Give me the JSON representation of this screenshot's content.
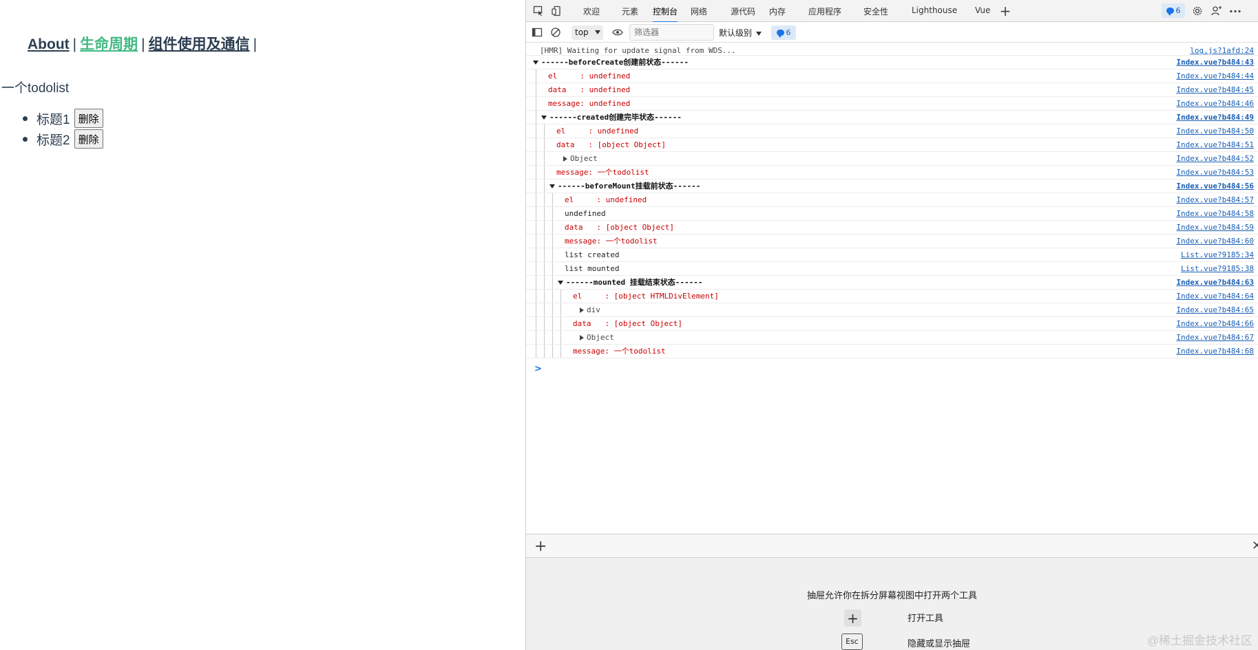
{
  "app": {
    "nav": [
      {
        "label": "About",
        "active": false
      },
      {
        "label": "生命周期",
        "active": true
      },
      {
        "label": "组件使用及通信",
        "active": false
      }
    ],
    "separator": "|",
    "message": "一个todolist",
    "todos": [
      {
        "title": "标题1",
        "button": "删除"
      },
      {
        "title": "标题2",
        "button": "删除"
      }
    ]
  },
  "devtools": {
    "tabs": [
      "欢迎",
      "元素",
      "控制台",
      "网络",
      "源代码",
      "内存",
      "应用程序",
      "安全性",
      "Lighthouse",
      "Vue"
    ],
    "active_tab": "控制台",
    "issues_count": "6",
    "toolbar": {
      "context": "top",
      "filter_placeholder": "筛选器",
      "levels": "默认级别",
      "issues_count": "6"
    },
    "console": [
      {
        "text": "[HMR] Waiting for update signal from WDS...",
        "src": "log.js?1afd:24",
        "color": "gray",
        "indent": 0
      },
      {
        "text": "------beforeCreate创建前状态------",
        "src": "Index.vue?b484:43",
        "color": "bold",
        "indent": 0,
        "group": true
      },
      {
        "text": "el     : undefined",
        "src": "Index.vue?b484:44",
        "color": "red",
        "indent": 1
      },
      {
        "text": "data   : undefined",
        "src": "Index.vue?b484:45",
        "color": "red",
        "indent": 1
      },
      {
        "text": "message: undefined",
        "src": "Index.vue?b484:46",
        "color": "red",
        "indent": 1
      },
      {
        "text": "------created创建完毕状态------",
        "src": "Index.vue?b484:49",
        "color": "bold",
        "indent": 1,
        "group": true
      },
      {
        "text": "el     : undefined",
        "src": "Index.vue?b484:50",
        "color": "red",
        "indent": 2
      },
      {
        "text": "data   : [object Object]",
        "src": "Index.vue?b484:51",
        "color": "red",
        "indent": 2
      },
      {
        "text": "Object",
        "src": "Index.vue?b484:52",
        "color": "gray",
        "indent": 2,
        "expand": true
      },
      {
        "text": "message: 一个todolist",
        "src": "Index.vue?b484:53",
        "color": "red",
        "indent": 2
      },
      {
        "text": "------beforeMount挂载前状态------",
        "src": "Index.vue?b484:56",
        "color": "bold",
        "indent": 2,
        "group": true
      },
      {
        "text": "el     : undefined",
        "src": "Index.vue?b484:57",
        "color": "red",
        "indent": 3
      },
      {
        "text": "undefined",
        "src": "Index.vue?b484:58",
        "color": "dark",
        "indent": 3
      },
      {
        "text": "data   : [object Object]",
        "src": "Index.vue?b484:59",
        "color": "red",
        "indent": 3
      },
      {
        "text": "message: 一个todolist",
        "src": "Index.vue?b484:60",
        "color": "red",
        "indent": 3
      },
      {
        "text": "list created",
        "src": "List.vue?9185:34",
        "color": "dark",
        "indent": 3
      },
      {
        "text": "list mounted",
        "src": "List.vue?9185:38",
        "color": "dark",
        "indent": 3
      },
      {
        "text": "------mounted 挂载结束状态------",
        "src": "Index.vue?b484:63",
        "color": "bold",
        "indent": 3,
        "group": true
      },
      {
        "text": "el     : [object HTMLDivElement]",
        "src": "Index.vue?b484:64",
        "color": "red",
        "indent": 4
      },
      {
        "text": "div",
        "src": "Index.vue?b484:65",
        "color": "gray",
        "indent": 4,
        "expand": true
      },
      {
        "text": "data   : [object Object]",
        "src": "Index.vue?b484:66",
        "color": "red",
        "indent": 4
      },
      {
        "text": "Object",
        "src": "Index.vue?b484:67",
        "color": "gray",
        "indent": 4,
        "expand": true
      },
      {
        "text": "message: 一个todolist",
        "src": "Index.vue?b484:68",
        "color": "red",
        "indent": 4
      }
    ],
    "drawer": {
      "hint": "抽屉允许你在拆分屏幕视图中打开两个工具",
      "open_tool": "打开工具",
      "esc_key": "Esc",
      "toggle_drawer": "隐藏或显示抽屉"
    }
  },
  "watermark": "@稀土掘金技术社区",
  "colors": {
    "vue_green": "#42b983",
    "vue_dark": "#2c3e50",
    "console_red": "#c80000",
    "link_blue": "#1a5fb4"
  }
}
